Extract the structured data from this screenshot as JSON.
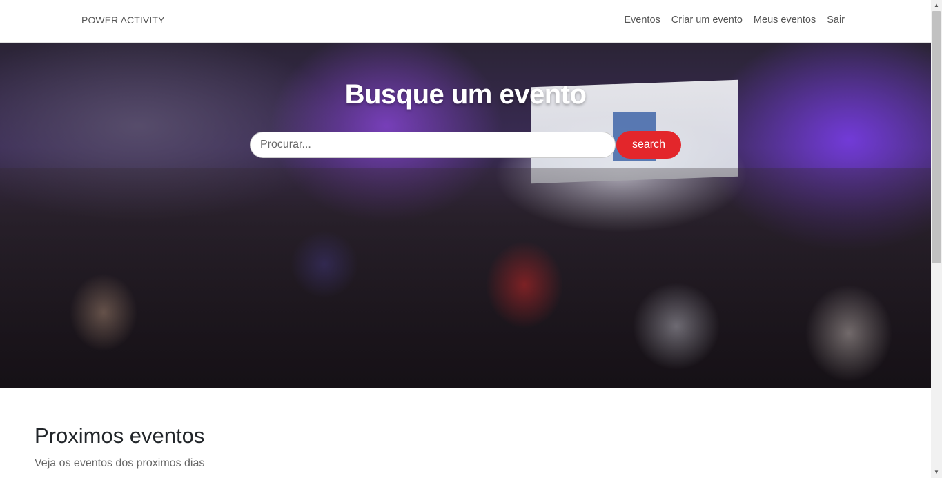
{
  "navbar": {
    "brand": "POWER ACTIVITY",
    "links": [
      {
        "label": "Eventos"
      },
      {
        "label": "Criar um evento"
      },
      {
        "label": "Meus eventos"
      },
      {
        "label": "Sair"
      }
    ]
  },
  "hero": {
    "title": "Busque um evento",
    "search_placeholder": "Procurar...",
    "search_button": "search",
    "accent": "#e3262b"
  },
  "section": {
    "title": "Proximos eventos",
    "subtitle": "Veja os eventos dos proximos dias"
  },
  "scrollbar": {
    "up_icon": "▲",
    "down_icon": "▼"
  }
}
